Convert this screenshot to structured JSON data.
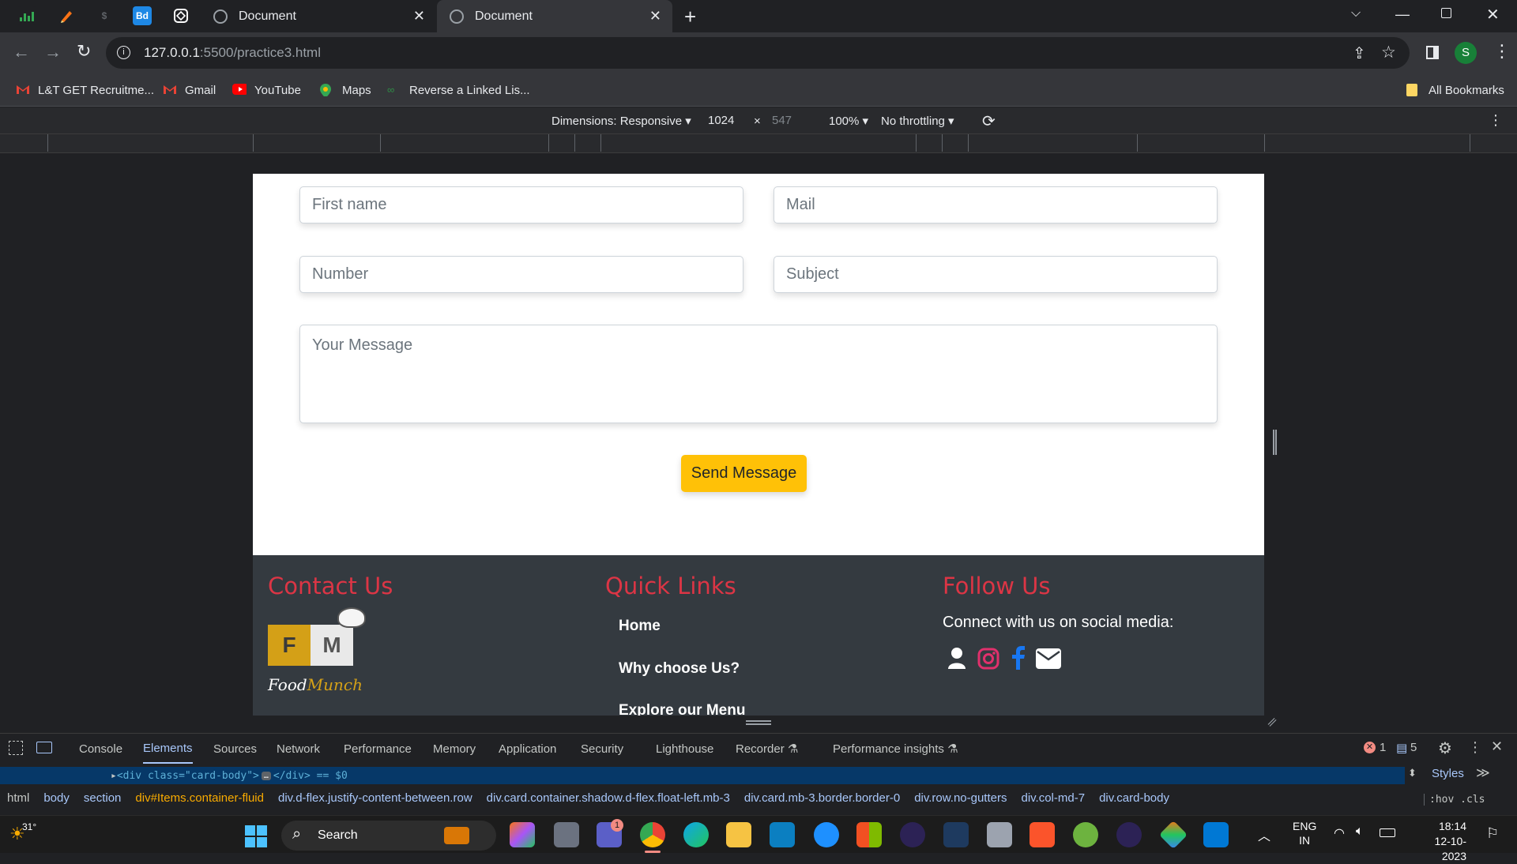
{
  "browser": {
    "tabs": [
      {
        "title": "Document",
        "active": false
      },
      {
        "title": "Document",
        "active": true
      }
    ],
    "pinned_tab_icons": [
      "sheets-icon",
      "pencil-icon",
      "dollar-icon",
      "bd-icon",
      "codepen-icon"
    ],
    "url_host": "127.0.0.1",
    "url_path": ":5500/practice3.html",
    "profile_initial": "S",
    "bookmarks": [
      {
        "label": "L&T GET Recruitme...",
        "icon": "gmail-icon"
      },
      {
        "label": "Gmail",
        "icon": "gmail-icon"
      },
      {
        "label": "YouTube",
        "icon": "youtube-icon"
      },
      {
        "label": "Maps",
        "icon": "maps-icon"
      },
      {
        "label": "Reverse a Linked Lis...",
        "icon": "link-icon"
      }
    ],
    "all_bookmarks": "All Bookmarks"
  },
  "device_toolbar": {
    "dimensions_label": "Dimensions: Responsive",
    "width": "1024",
    "times": "×",
    "height": "547",
    "zoom": "100%",
    "throttling": "No throttling"
  },
  "page": {
    "form": {
      "first_name_placeholder": "First name",
      "mail_placeholder": "Mail",
      "number_placeholder": "Number",
      "subject_placeholder": "Subject",
      "message_placeholder": "Your Message",
      "send_label": "Send Message"
    },
    "footer": {
      "contact_heading": "Contact Us",
      "logo_letters": [
        "F",
        "M"
      ],
      "logo_text_1": "Food",
      "logo_text_2": "Munch",
      "links_heading": "Quick Links",
      "links": [
        "Home",
        "Why choose Us?",
        "Explore our Menu"
      ],
      "follow_heading": "Follow Us",
      "follow_text": "Connect with us on social media:",
      "social_icons": [
        "user-icon",
        "instagram-icon",
        "facebook-icon",
        "envelope-icon"
      ],
      "colors": {
        "heading": "#dc3545",
        "instagram": "#e1306c",
        "facebook": "#1877f2"
      }
    }
  },
  "devtools": {
    "tabs": [
      "Console",
      "Elements",
      "Sources",
      "Network",
      "Performance",
      "Memory",
      "Application",
      "Security",
      "Lighthouse",
      "Recorder",
      "Performance insights"
    ],
    "active_tab": "Elements",
    "error_count": "1",
    "message_count": "5",
    "dom_line": "<div class=\"card-body\">",
    "dom_line_end": "</div> == $0",
    "breadcrumbs": [
      "html",
      "body",
      "section",
      "div#Items.container-fluid",
      "div.d-flex.justify-content-between.row",
      "div.card.container.shadow.d-flex.float-left.mb-3",
      "div.card.mb-3.border.border-0",
      "div.row.no-gutters",
      "div.col-md-7",
      "div.card-body"
    ],
    "styles_label": "Styles",
    "styles_filter": ":hov .cls"
  },
  "taskbar": {
    "temperature": "31°",
    "search_label": "Search",
    "lang_1": "ENG",
    "lang_2": "IN",
    "time": "18:14",
    "date": "12-10-2023",
    "teams_badge": "1"
  }
}
